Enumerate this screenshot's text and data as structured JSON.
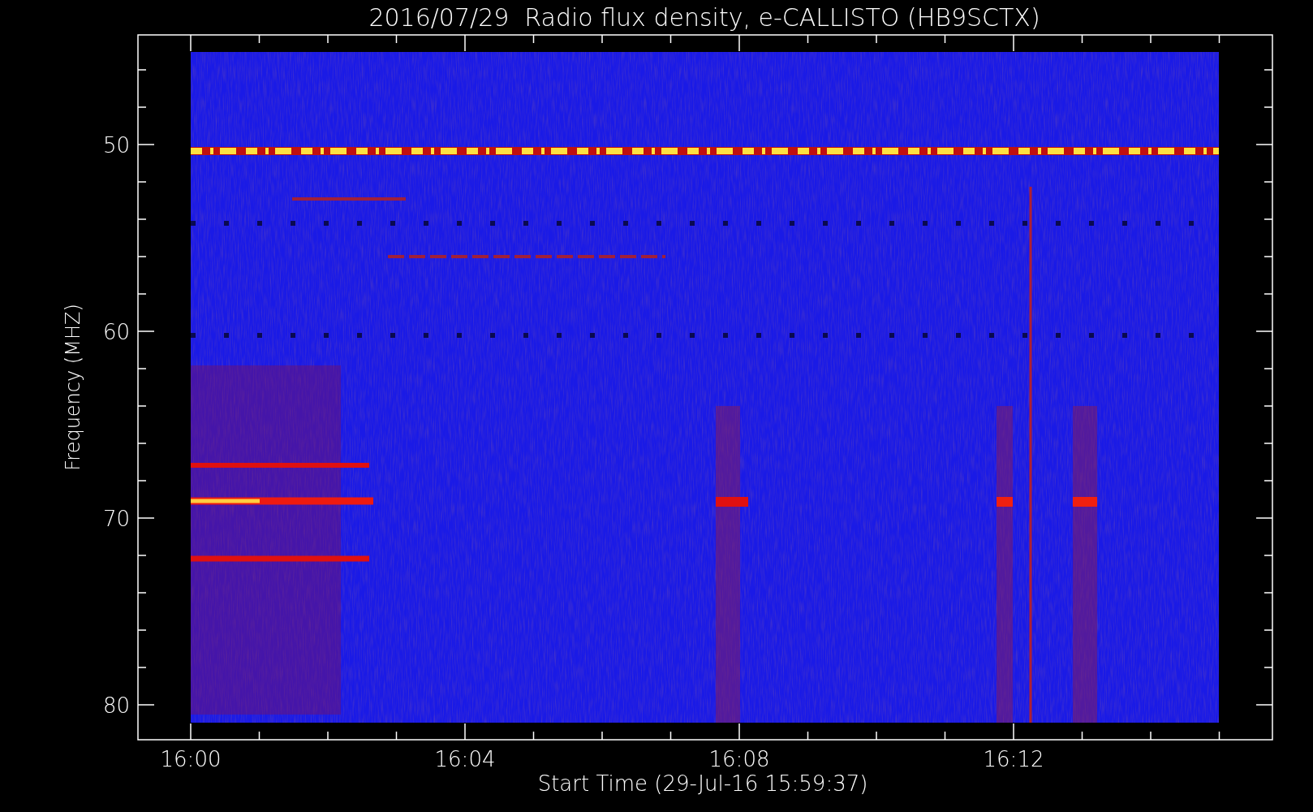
{
  "title": "2016/07/29  Radio flux density, e-CALLISTO (HB9SCTX)",
  "y_axis": {
    "label": "Frequency (MHZ)",
    "ticks": [
      "50",
      "60",
      "70",
      "80"
    ]
  },
  "x_axis": {
    "label": "Start Time (29-Jul-16 15:59:37)",
    "ticks": [
      "16:00",
      "16:04",
      "16:08",
      "16:12"
    ]
  }
}
